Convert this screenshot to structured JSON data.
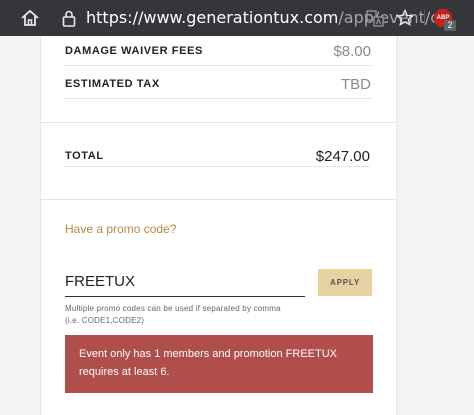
{
  "browser": {
    "url_main": "https://www.generationtux.com",
    "url_rest": "/app/event/c...",
    "ext_badge": "2",
    "ext_label": "ABP"
  },
  "fees": {
    "damage_waiver_label": "DAMAGE WAIVER FEES",
    "damage_waiver_value": "$8.00",
    "tax_label": "ESTIMATED TAX",
    "tax_value": "TBD"
  },
  "total": {
    "label": "TOTAL",
    "value": "$247.00"
  },
  "promo": {
    "link": "Have a promo code?",
    "input_value": "FREETUX",
    "apply_label": "APPLY",
    "hint_line1": "Multiple promo codes can be used if separated by comma",
    "hint_line2": "(i.e. CODE1,CODE2)",
    "error_line1": "Event only has 1 members and promotion FREETUX",
    "error_line2": "requires at least 6."
  }
}
